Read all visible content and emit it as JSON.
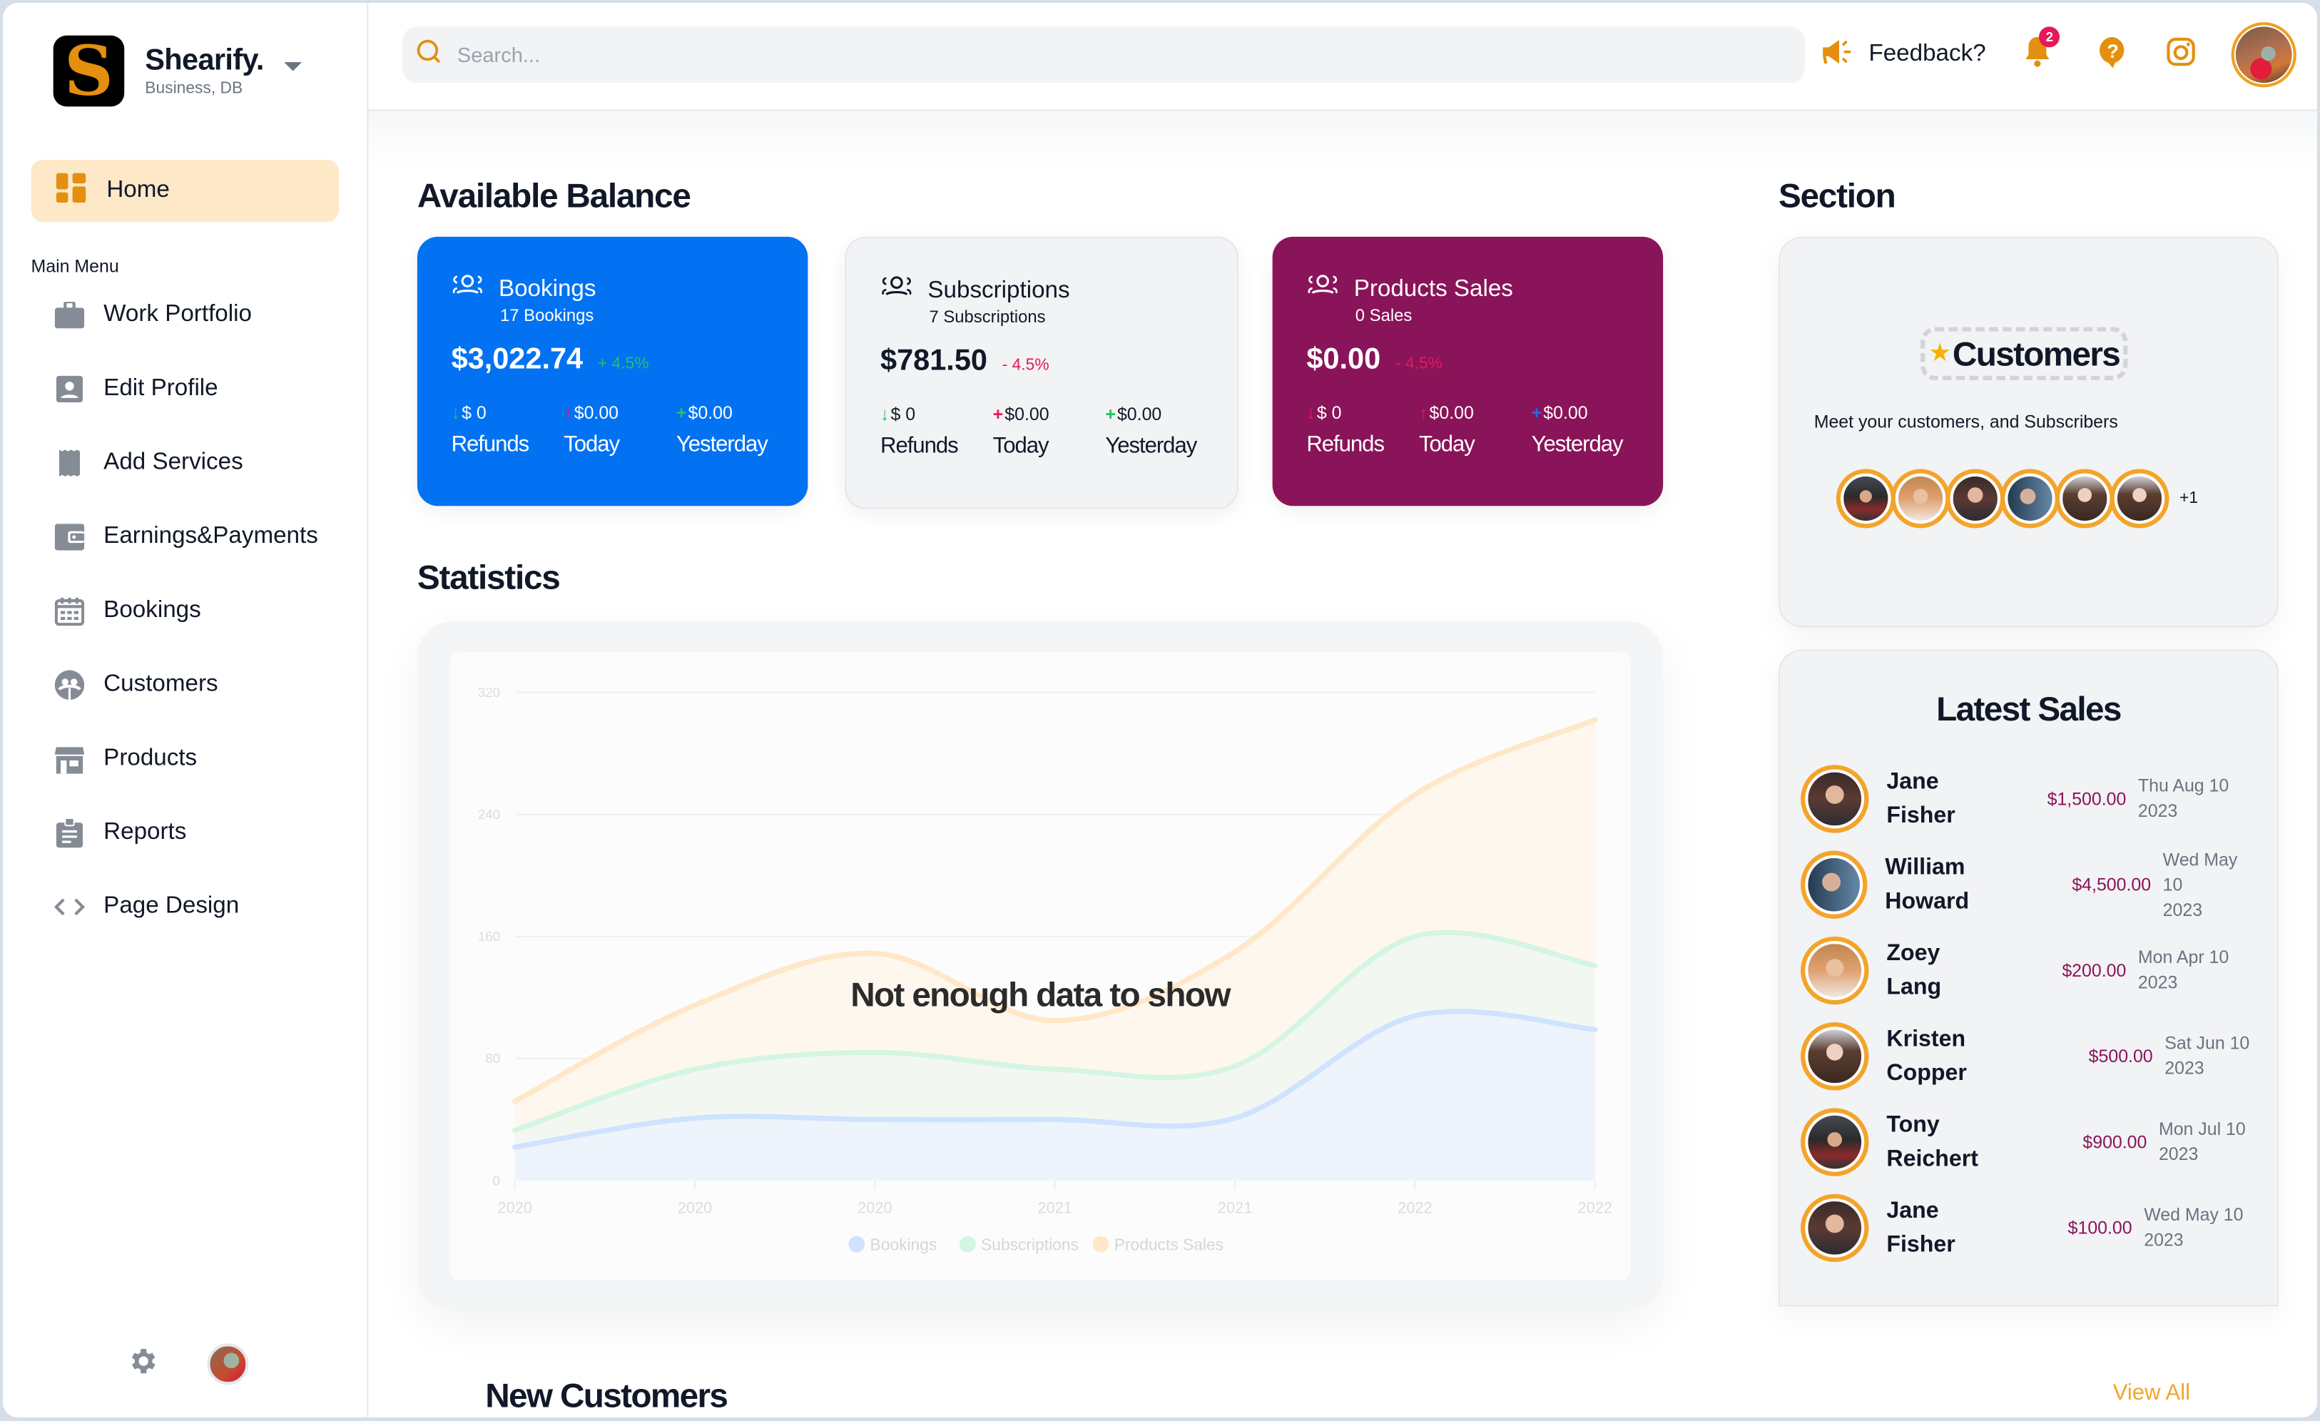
{
  "brand": {
    "name": "Shearify.",
    "subtitle": "Business, DB",
    "logo_letter": "S"
  },
  "sidebar": {
    "home": {
      "label": "Home",
      "icon": "dashboard-icon",
      "active": true
    },
    "menu_title": "Main Menu",
    "items": [
      {
        "label": "Work Portfolio",
        "icon": "briefcase-icon"
      },
      {
        "label": "Edit Profile",
        "icon": "profile-card-icon"
      },
      {
        "label": "Add Services",
        "icon": "receipt-icon"
      },
      {
        "label": "Earnings&Payments",
        "icon": "wallet-icon"
      },
      {
        "label": "Bookings",
        "icon": "calendar-icon"
      },
      {
        "label": "Customers",
        "icon": "customers-icon"
      },
      {
        "label": "Products",
        "icon": "store-icon"
      },
      {
        "label": "Reports",
        "icon": "clipboard-icon"
      },
      {
        "label": "Page Design",
        "icon": "code-icon"
      }
    ],
    "bottom": {
      "settings_icon": "gear-icon",
      "avatar": "user-avatar"
    }
  },
  "topbar": {
    "search_placeholder": "Search...",
    "search_value": "",
    "feedback_label": "Feedback?",
    "notifications_count": "2",
    "icons": [
      "megaphone-icon",
      "bell-icon",
      "help-icon",
      "instagram-icon"
    ]
  },
  "colors": {
    "accent": "#e48f0f",
    "bookings_card": "#0272f3",
    "subscriptions_card": "#f2f3f5",
    "products_card": "#8a1459",
    "positive": "#22c55e",
    "negative": "#e6185a"
  },
  "balance": {
    "title": "Available Balance",
    "cards": [
      {
        "title": "Bookings",
        "subtitle": "17 Bookings",
        "amount": "$3,022.74",
        "delta": "+ 4.5%",
        "stats": [
          {
            "arrow": "↓",
            "value": "$ 0",
            "label": "Refunds"
          },
          {
            "arrow": "↑",
            "value": "$0.00",
            "label": "Today"
          },
          {
            "arrow": "+",
            "value": "$0.00",
            "label": "Yesterday"
          }
        ]
      },
      {
        "title": "Subscriptions",
        "subtitle": "7 Subscriptions",
        "amount": "$781.50",
        "delta": "- 4.5%",
        "stats": [
          {
            "arrow": "↓",
            "value": "$ 0",
            "label": "Refunds"
          },
          {
            "arrow": "+",
            "value": "$0.00",
            "label": "Today"
          },
          {
            "arrow": "+",
            "value": "$0.00",
            "label": "Yesterday"
          }
        ]
      },
      {
        "title": "Products Sales",
        "subtitle": "0 Sales",
        "amount": "$0.00",
        "delta": "- 4.5%",
        "stats": [
          {
            "arrow": "↓",
            "value": "$ 0",
            "label": "Refunds"
          },
          {
            "arrow": "↑",
            "value": "$0.00",
            "label": "Today"
          },
          {
            "arrow": "+",
            "value": "$0.00",
            "label": "Yesterday"
          }
        ]
      }
    ]
  },
  "statistics": {
    "title": "Statistics",
    "overlay_message": "Not enough data to show"
  },
  "chart_data": {
    "type": "area",
    "stacked": true,
    "title": "",
    "xlabel": "",
    "ylabel": "",
    "x": [
      "2020",
      "2020",
      "2020",
      "2021",
      "2021",
      "2022",
      "2022"
    ],
    "y_ticks": [
      0,
      80,
      160,
      240,
      320
    ],
    "ylim": [
      0,
      320
    ],
    "grid": true,
    "legend_position": "bottom",
    "series": [
      {
        "name": "Bookings",
        "color": "#cfe2ff",
        "values": [
          22,
          41,
          40,
          40,
          41,
          108,
          99
        ]
      },
      {
        "name": "Subscriptions",
        "color": "#d5f5e3",
        "values": [
          11,
          32,
          44,
          33,
          34,
          52,
          42
        ]
      },
      {
        "name": "Products Sales",
        "color": "#ffe7c7",
        "values": [
          19,
          42,
          65,
          32,
          75,
          93,
          161
        ]
      }
    ]
  },
  "section": {
    "title": "Section",
    "customers_tag": "Customers",
    "customers_desc": "Meet your customers, and Subscribers",
    "avatars_more": "+1"
  },
  "latest_sales": {
    "title": "Latest Sales",
    "rows": [
      {
        "first": "Jane",
        "last": "Fisher",
        "amount": "$1,500.00",
        "date1": "Thu Aug 10",
        "date2": "2023"
      },
      {
        "first": "William",
        "last": "Howard",
        "amount": "$4,500.00",
        "date1": "Wed May 10",
        "date2": "2023"
      },
      {
        "first": "Zoey",
        "last": "Lang",
        "amount": "$200.00",
        "date1": "Mon Apr 10",
        "date2": "2023"
      },
      {
        "first": "Kristen",
        "last": "Copper",
        "amount": "$500.00",
        "date1": "Sat Jun 10",
        "date2": "2023"
      },
      {
        "first": "Tony",
        "last": "Reichert",
        "amount": "$900.00",
        "date1": "Mon Jul 10",
        "date2": "2023"
      },
      {
        "first": "Jane",
        "last": "Fisher",
        "amount": "$100.00",
        "date1": "Wed May 10",
        "date2": "2023"
      }
    ]
  },
  "new_customers": {
    "title": "New Customers",
    "view_all": "View All"
  }
}
